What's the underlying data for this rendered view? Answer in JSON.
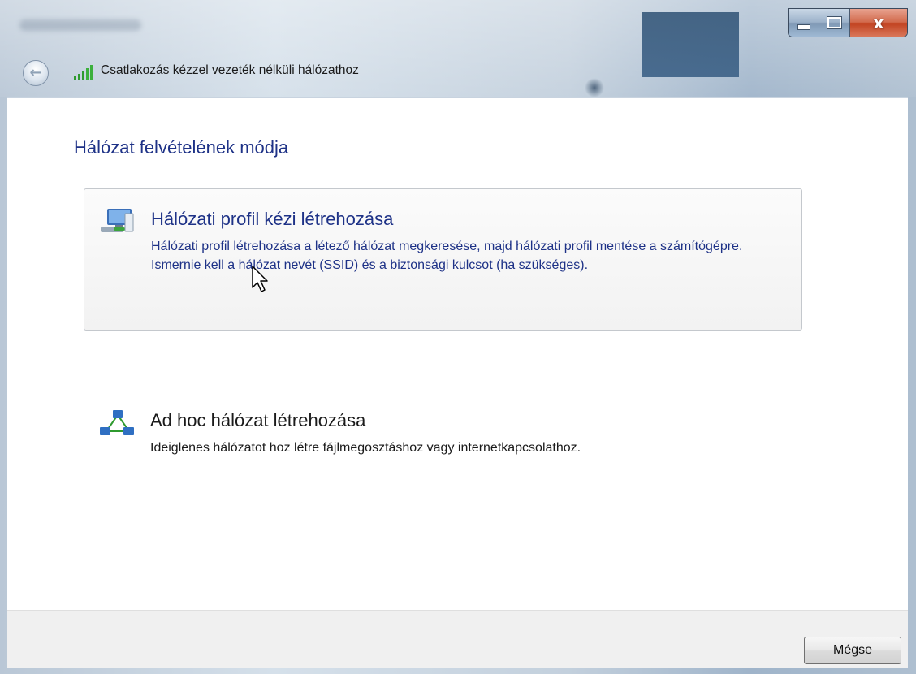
{
  "window": {
    "title": "Csatlakozás kézzel vezeték nélküli hálózathoz",
    "caption_buttons": [
      "minimize",
      "maximize",
      "close"
    ],
    "close_glyph": "x"
  },
  "nav": {
    "back_icon": "back-arrow-icon",
    "signal_icon": "wireless-signal-icon"
  },
  "main": {
    "heading": "Hálózat felvételének módja",
    "options": [
      {
        "icon": "network-profile-icon",
        "title": "Hálózati profil kézi létrehozása",
        "description": "Hálózati profil létrehozása a létező hálózat megkeresése, majd hálózati profil mentése a számítógépre. Ismernie kell a hálózat nevét (SSID) és a biztonsági kulcsot (ha szükséges).",
        "state": "hover"
      },
      {
        "icon": "ad-hoc-network-icon",
        "title": "Ad hoc hálózat létrehozása",
        "description": "Ideiglenes hálózatot hoz létre fájlmegosztáshoz vagy internetkapcsolathoz.",
        "state": "normal"
      }
    ]
  },
  "footer": {
    "cancel_label": "Mégse"
  },
  "colors": {
    "link_blue": "#1e3287",
    "close_red": "#c1411f",
    "footer_bg": "#f0f0f0"
  }
}
